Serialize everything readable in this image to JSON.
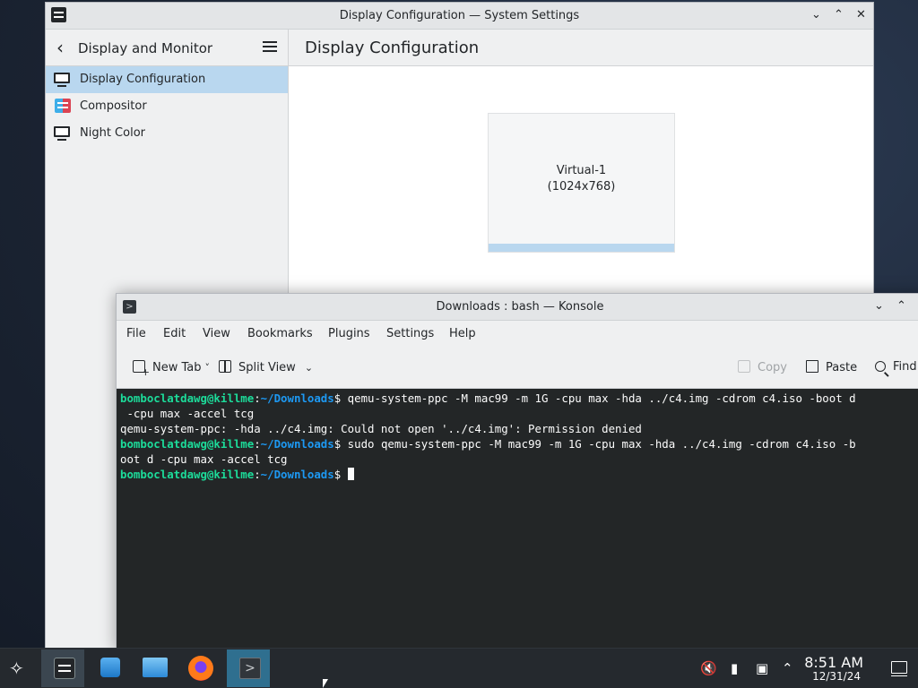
{
  "settings_window": {
    "title": "Display Configuration — System Settings",
    "sidebar": {
      "heading": "Display and Monitor",
      "items": [
        {
          "label": "Display Configuration",
          "icon": "monitor-icon",
          "active": true
        },
        {
          "label": "Compositor",
          "icon": "compositor-icon",
          "active": false
        },
        {
          "label": "Night Color",
          "icon": "monitor-icon",
          "active": false
        }
      ]
    },
    "main": {
      "title": "Display Configuration",
      "screen": {
        "name": "Virtual-1",
        "resolution": "(1024x768)"
      }
    }
  },
  "konsole_window": {
    "title": "Downloads : bash — Konsole",
    "menu": [
      "File",
      "Edit",
      "View",
      "Bookmarks",
      "Plugins",
      "Settings",
      "Help"
    ],
    "toolbar": {
      "new_tab": "New Tab",
      "split_view": "Split View",
      "copy": "Copy",
      "paste": "Paste",
      "find": "Find"
    },
    "terminal": {
      "prompt_user": "bomboclatdawg@killme",
      "prompt_path": "~/Downloads",
      "line1_cmd": " qemu-system-ppc -M mac99 -m 1G -cpu max -hda ../c4.img -cdrom c4.iso -boot d",
      "line1_wrap": " -cpu max -accel tcg",
      "error": "qemu-system-ppc: -hda ../c4.img: Could not open '../c4.img': Permission denied",
      "line2_cmd": " sudo qemu-system-ppc -M mac99 -m 1G -cpu max -hda ../c4.img -cdrom c4.iso -b",
      "line2_wrap": "oot d -cpu max -accel tcg",
      "colors": {
        "user": "#1cdc9a",
        "path": "#1d99f3",
        "background": "#232627"
      }
    }
  },
  "taskbar": {
    "apps": [
      "application-launcher",
      "system-settings",
      "discover",
      "dolphin-files",
      "firefox",
      "konsole"
    ],
    "tray_icons": [
      "volume-muted-icon",
      "battery-icon",
      "network-icon",
      "tray-expand-icon"
    ],
    "clock": {
      "time": "8:51 AM",
      "date": "12/31/24"
    }
  }
}
